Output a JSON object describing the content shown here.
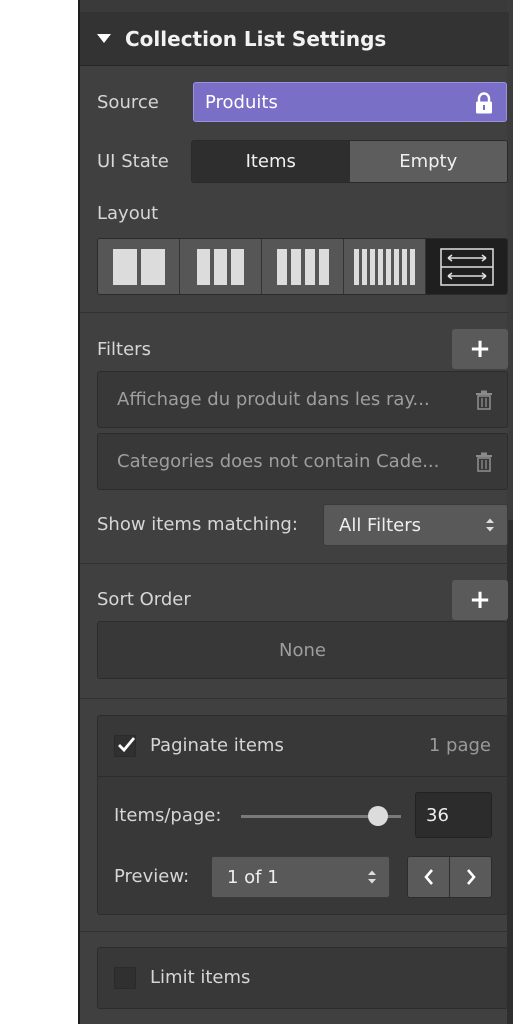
{
  "panel": {
    "title": "Collection List Settings",
    "source": {
      "label": "Source",
      "value": "Produits"
    },
    "ui_state": {
      "label": "UI State",
      "options": [
        "Items",
        "Empty"
      ],
      "selected": "Items"
    },
    "layout": {
      "label": "Layout",
      "options": [
        "2-columns",
        "3-columns",
        "4-columns",
        "6-columns",
        "list-rows"
      ],
      "selected": "list-rows"
    },
    "filters": {
      "label": "Filters",
      "add_label": "+",
      "items": [
        "Affichage du produit dans les ray...",
        "Categories does not contain Cade..."
      ],
      "match_label": "Show items matching:",
      "match_value": "All Filters"
    },
    "sort": {
      "label": "Sort Order",
      "add_label": "+",
      "value": "None"
    },
    "paginate": {
      "checked": true,
      "label": "Paginate items",
      "count": "1 page",
      "items_per_page_label": "Items/page:",
      "items_per_page": "36",
      "preview_label": "Preview:",
      "preview_value": "1 of 1"
    },
    "limit": {
      "checked": false,
      "label": "Limit items"
    }
  },
  "colors": {
    "panel_bg": "#404040",
    "header_bg": "#333333",
    "source_accent": "#7a6fc6",
    "active_segment": "#2e2e2e"
  }
}
